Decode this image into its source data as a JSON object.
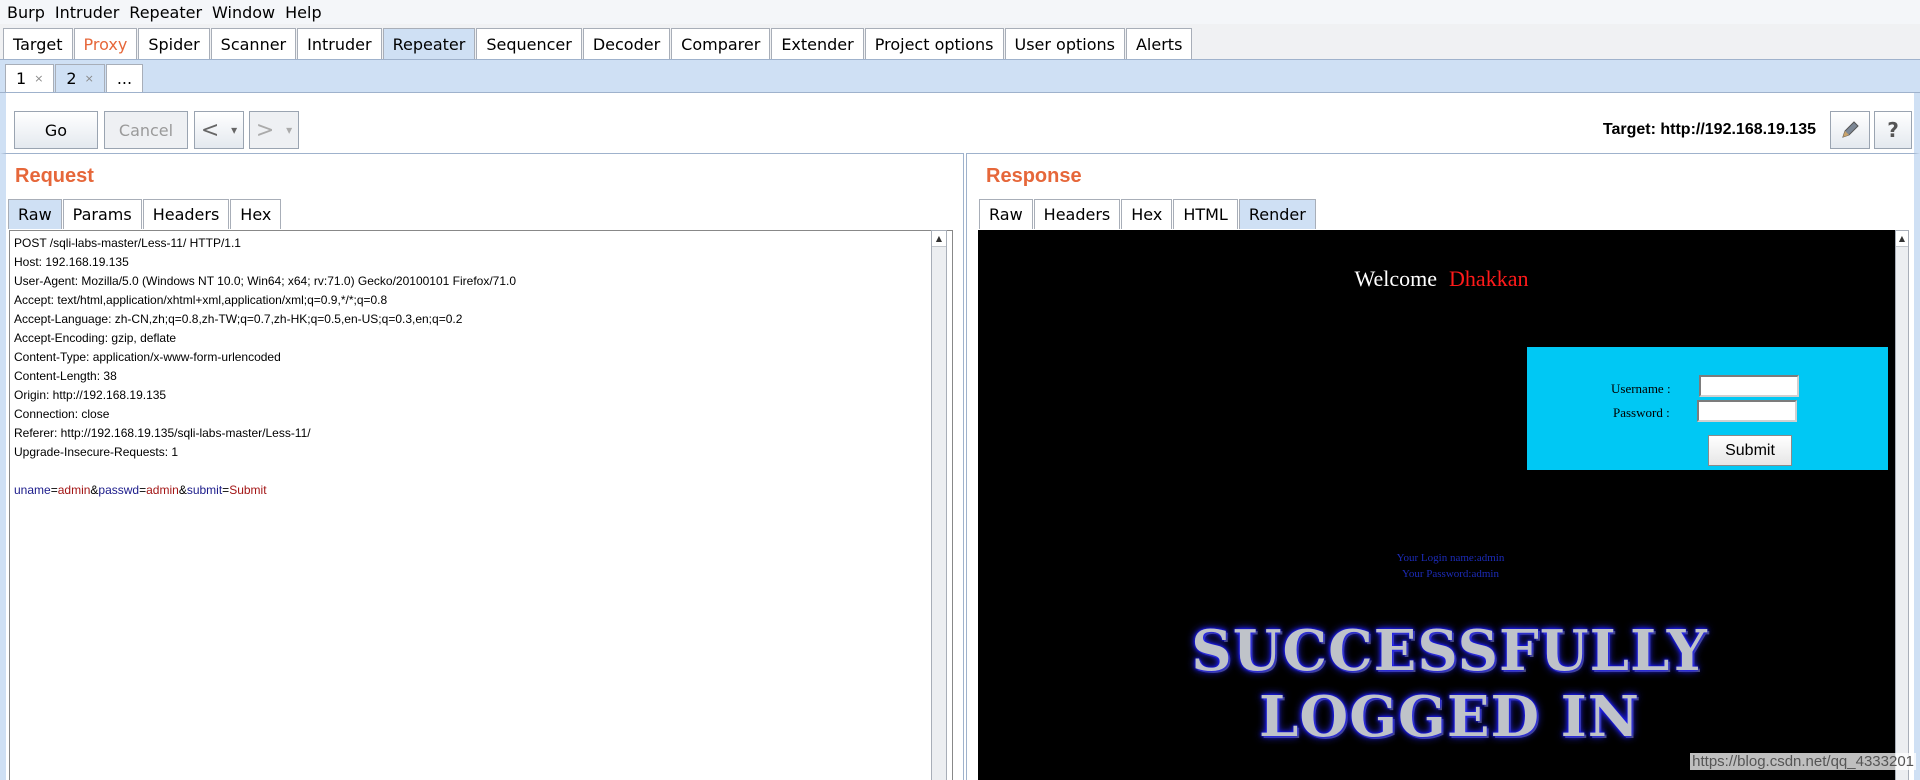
{
  "menu": [
    "Burp",
    "Intruder",
    "Repeater",
    "Window",
    "Help"
  ],
  "main_tabs": [
    {
      "label": "Target"
    },
    {
      "label": "Proxy"
    },
    {
      "label": "Spider"
    },
    {
      "label": "Scanner"
    },
    {
      "label": "Intruder"
    },
    {
      "label": "Repeater"
    },
    {
      "label": "Sequencer"
    },
    {
      "label": "Decoder"
    },
    {
      "label": "Comparer"
    },
    {
      "label": "Extender"
    },
    {
      "label": "Project options"
    },
    {
      "label": "User options"
    },
    {
      "label": "Alerts"
    }
  ],
  "active_main_tab": "Repeater",
  "highlight_tab": "Proxy",
  "sub_tabs": [
    {
      "label": "1",
      "close": "×"
    },
    {
      "label": "2",
      "close": "×"
    },
    {
      "label": "..."
    }
  ],
  "toolbar": {
    "go": "Go",
    "cancel": "Cancel",
    "back": "<",
    "forward": ">",
    "dropdown": "▾",
    "target": "Target: http://192.168.19.135",
    "edit_icon": "pencil-icon",
    "help": "?"
  },
  "request": {
    "title": "Request",
    "tabs": [
      "Raw",
      "Params",
      "Headers",
      "Hex"
    ],
    "active_tab": "Raw",
    "lines": [
      "POST /sqli-labs-master/Less-11/ HTTP/1.1",
      "Host: 192.168.19.135",
      "User-Agent: Mozilla/5.0 (Windows NT 10.0; Win64; x64; rv:71.0) Gecko/20100101 Firefox/71.0",
      "Accept: text/html,application/xhtml+xml,application/xml;q=0.9,*/*;q=0.8",
      "Accept-Language: zh-CN,zh;q=0.8,zh-TW;q=0.7,zh-HK;q=0.5,en-US;q=0.3,en;q=0.2",
      "Accept-Encoding: gzip, deflate",
      "Content-Type: application/x-www-form-urlencoded",
      "Content-Length: 38",
      "Origin: http://192.168.19.135",
      "Connection: close",
      "Referer: http://192.168.19.135/sqli-labs-master/Less-11/",
      "Upgrade-Insecure-Requests: 1",
      ""
    ],
    "body_params": [
      {
        "name": "uname",
        "value": "admin"
      },
      {
        "name": "passwd",
        "value": "admin"
      },
      {
        "name": "submit",
        "value": "Submit"
      }
    ]
  },
  "response": {
    "title": "Response",
    "tabs": [
      "Raw",
      "Headers",
      "Hex",
      "HTML",
      "Render"
    ],
    "active_tab": "Render",
    "render": {
      "welcome": "Welcome",
      "user": "Dhakkan",
      "username_label": "Username :",
      "password_label": "Password :",
      "submit": "Submit",
      "login_name": "Your Login name:admin",
      "login_password": "Your Password:admin",
      "success_line1": "SUCCESSFULLY",
      "success_line2": "LOGGED IN"
    }
  },
  "watermark": "https://blog.csdn.net/qq_4333201",
  "colors": {
    "accent_orange": "#e6673a",
    "tab_active": "#cfe0f4",
    "render_box": "#00c8f4",
    "user_red": "#ff1a1a",
    "param_name": "#1a1a8a",
    "param_value": "#a31515"
  }
}
